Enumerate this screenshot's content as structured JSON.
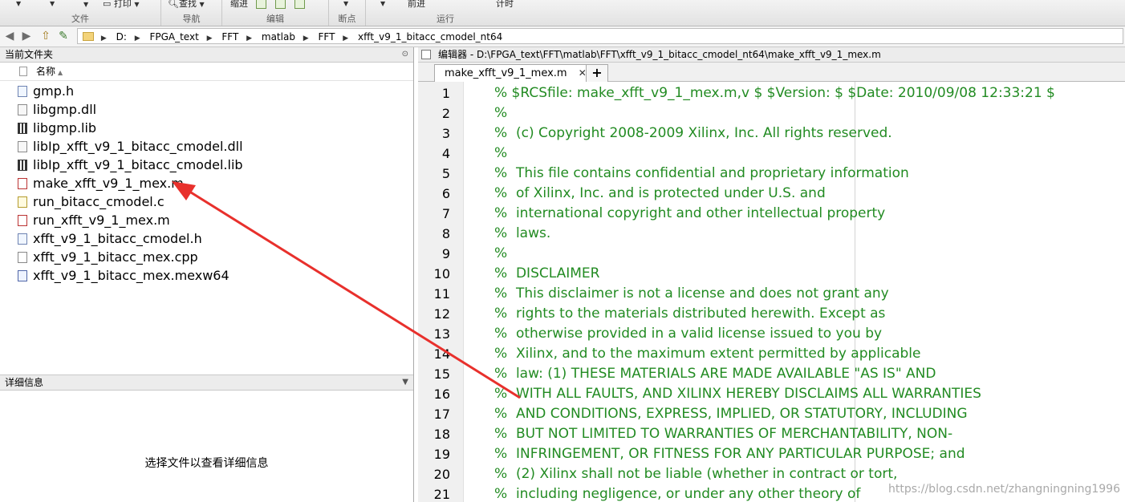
{
  "ribbon": {
    "groups": [
      {
        "label": "文件"
      },
      {
        "label": "导航"
      },
      {
        "label": "编辑"
      },
      {
        "label": "断点"
      },
      {
        "label": "运行"
      }
    ],
    "print_label": "打印",
    "find_label": "查找",
    "indent_label": "缩进",
    "forward_label": "前进",
    "timer_label": "计时"
  },
  "address": {
    "path": [
      "D:",
      "FPGA_text",
      "FFT",
      "matlab",
      "FFT",
      "xfft_v9_1_bitacc_cmodel_nt64"
    ],
    "separator": "▶"
  },
  "current_folder": {
    "title": "当前文件夹",
    "column_name": "名称",
    "files": [
      {
        "name": "gmp.h",
        "type": "h"
      },
      {
        "name": "libgmp.dll",
        "type": "dll"
      },
      {
        "name": "libgmp.lib",
        "type": "lib"
      },
      {
        "name": "libIp_xfft_v9_1_bitacc_cmodel.dll",
        "type": "dll"
      },
      {
        "name": "libIp_xfft_v9_1_bitacc_cmodel.lib",
        "type": "lib"
      },
      {
        "name": "make_xfft_v9_1_mex.m",
        "type": "m"
      },
      {
        "name": "run_bitacc_cmodel.c",
        "type": "c"
      },
      {
        "name": "run_xfft_v9_1_mex.m",
        "type": "m"
      },
      {
        "name": "xfft_v9_1_bitacc_cmodel.h",
        "type": "h"
      },
      {
        "name": "xfft_v9_1_bitacc_mex.cpp",
        "type": "cpp"
      },
      {
        "name": "xfft_v9_1_bitacc_mex.mexw64",
        "type": "mex"
      }
    ]
  },
  "details": {
    "title": "详细信息",
    "message": "选择文件以查看详细信息"
  },
  "editor": {
    "title": "编辑器 - D:\\FPGA_text\\FFT\\matlab\\FFT\\xfft_v9_1_bitacc_cmodel_nt64\\make_xfft_v9_1_mex.m",
    "tab_label": "make_xfft_v9_1_mex.m",
    "add_tab": "+",
    "lines": [
      {
        "n": "1",
        "text": "% $RCSfile: make_xfft_v9_1_mex.m,v $ $Version: $ $Date: 2010/09/08 12:33:21 $"
      },
      {
        "n": "2",
        "text": "%"
      },
      {
        "n": "3",
        "text": "%  (c) Copyright 2008-2009 Xilinx, Inc. All rights reserved."
      },
      {
        "n": "4",
        "text": "%"
      },
      {
        "n": "5",
        "text": "%  This file contains confidential and proprietary information"
      },
      {
        "n": "6",
        "text": "%  of Xilinx, Inc. and is protected under U.S. and"
      },
      {
        "n": "7",
        "text": "%  international copyright and other intellectual property"
      },
      {
        "n": "8",
        "text": "%  laws."
      },
      {
        "n": "9",
        "text": "%"
      },
      {
        "n": "10",
        "text": "%  DISCLAIMER"
      },
      {
        "n": "11",
        "text": "%  This disclaimer is not a license and does not grant any"
      },
      {
        "n": "12",
        "text": "%  rights to the materials distributed herewith. Except as"
      },
      {
        "n": "13",
        "text": "%  otherwise provided in a valid license issued to you by"
      },
      {
        "n": "14",
        "text": "%  Xilinx, and to the maximum extent permitted by applicable"
      },
      {
        "n": "15",
        "text": "%  law: (1) THESE MATERIALS ARE MADE AVAILABLE \"AS IS\" AND"
      },
      {
        "n": "16",
        "text": "%  WITH ALL FAULTS, AND XILINX HEREBY DISCLAIMS ALL WARRANTIES"
      },
      {
        "n": "17",
        "text": "%  AND CONDITIONS, EXPRESS, IMPLIED, OR STATUTORY, INCLUDING"
      },
      {
        "n": "18",
        "text": "%  BUT NOT LIMITED TO WARRANTIES OF MERCHANTABILITY, NON-"
      },
      {
        "n": "19",
        "text": "%  INFRINGEMENT, OR FITNESS FOR ANY PARTICULAR PURPOSE; and"
      },
      {
        "n": "20",
        "text": "%  (2) Xilinx shall not be liable (whether in contract or tort,"
      },
      {
        "n": "21",
        "text": "%  including negligence, or under any other theory of"
      }
    ]
  },
  "watermark": "https://blog.csdn.net/zhangningning1996",
  "colors": {
    "comment": "#228b22",
    "annotation_arrow": "#e8302c"
  }
}
